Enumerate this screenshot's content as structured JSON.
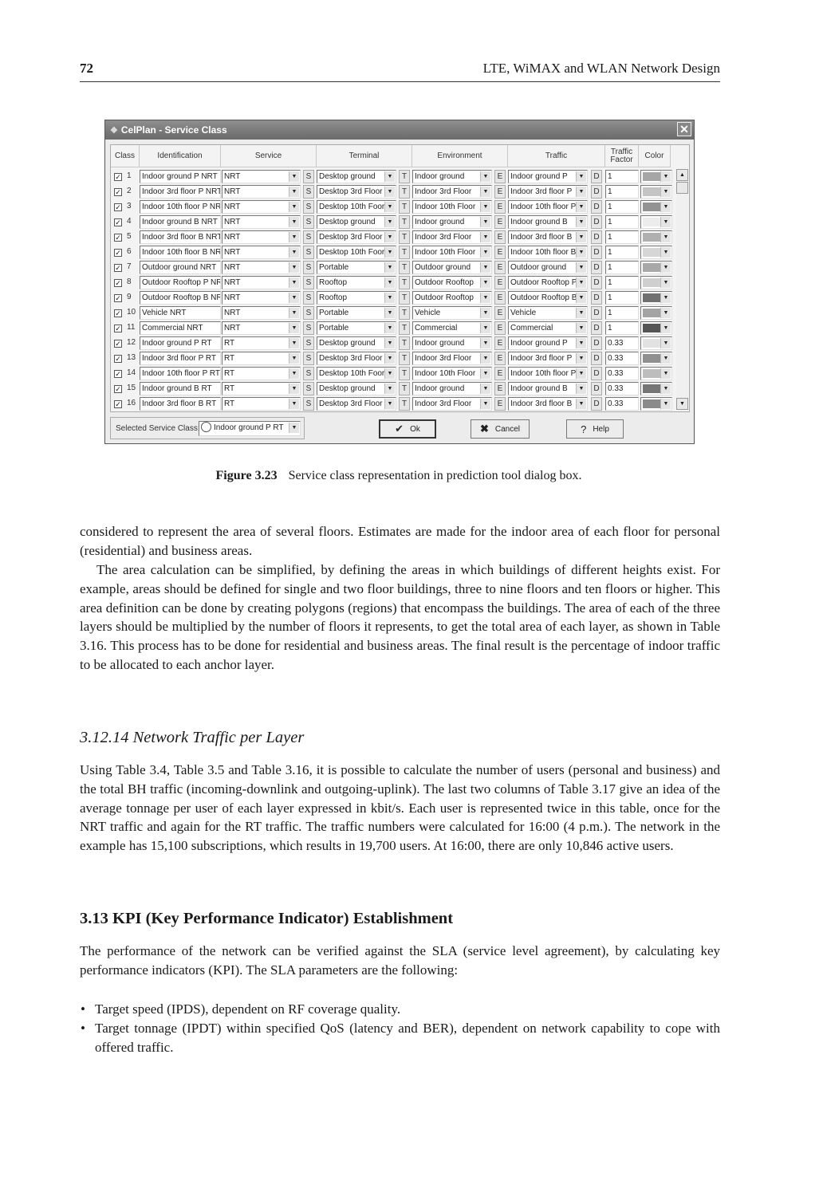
{
  "header": {
    "page_number": "72",
    "book_title": "LTE, WiMAX and WLAN Network Design"
  },
  "dialog": {
    "title": "CelPlan - Service Class",
    "close_icon": "close-icon",
    "columns": [
      "Class",
      "Identification",
      "Service",
      "Terminal",
      "Environment",
      "Traffic",
      "Traffic Factor",
      "Color"
    ],
    "button_letters": {
      "service": "S",
      "terminal": "T",
      "environment": "E",
      "traffic": "D"
    },
    "rows": [
      {
        "checked": true,
        "num": "1",
        "identification": "Indoor ground P NRT",
        "service": "NRT",
        "terminal": "Desktop ground",
        "environment": "Indoor ground",
        "traffic": "Indoor ground P",
        "factor": "1",
        "color": "#a6a6a6"
      },
      {
        "checked": true,
        "num": "2",
        "identification": "Indoor 3rd floor P NRT",
        "service": "NRT",
        "terminal": "Desktop 3rd Floor",
        "environment": "Indoor 3rd Floor",
        "traffic": "Indoor 3rd floor P",
        "factor": "1",
        "color": "#c4c4c4"
      },
      {
        "checked": true,
        "num": "3",
        "identification": "Indoor 10th floor P NR",
        "service": "NRT",
        "terminal": "Desktop 10th Foor",
        "environment": "Indoor 10th Floor",
        "traffic": "Indoor 10th floor P",
        "factor": "1",
        "color": "#939393"
      },
      {
        "checked": true,
        "num": "4",
        "identification": "Indoor ground B NRT",
        "service": "NRT",
        "terminal": "Desktop ground",
        "environment": "Indoor ground",
        "traffic": "Indoor ground B",
        "factor": "1",
        "color": "#ededed"
      },
      {
        "checked": true,
        "num": "5",
        "identification": "Indoor 3rd floor B NRT",
        "service": "NRT",
        "terminal": "Desktop 3rd Floor",
        "environment": "Indoor 3rd Floor",
        "traffic": "Indoor 3rd floor B",
        "factor": "1",
        "color": "#b0b0b0"
      },
      {
        "checked": true,
        "num": "6",
        "identification": "Indoor 10th floor B NR",
        "service": "NRT",
        "terminal": "Desktop 10th Foor",
        "environment": "Indoor 10th Floor",
        "traffic": "Indoor 10th floor B",
        "factor": "1",
        "color": "#d6d6d6"
      },
      {
        "checked": true,
        "num": "7",
        "identification": "Outdoor ground NRT",
        "service": "NRT",
        "terminal": "Portable",
        "environment": "Outdoor ground",
        "traffic": "Outdoor ground",
        "factor": "1",
        "color": "#a8a8a8"
      },
      {
        "checked": true,
        "num": "8",
        "identification": "Outdoor Rooftop P NR",
        "service": "NRT",
        "terminal": "Rooftop",
        "environment": "Outdoor Rooftop",
        "traffic": "Outdoor Rooftop P",
        "factor": "1",
        "color": "#cfcfcf"
      },
      {
        "checked": true,
        "num": "9",
        "identification": "Outdoor Rooftop B NR",
        "service": "NRT",
        "terminal": "Rooftop",
        "environment": "Outdoor Rooftop",
        "traffic": "Outdoor Rooftop B",
        "factor": "1",
        "color": "#707070"
      },
      {
        "checked": true,
        "num": "10",
        "identification": "Vehicle NRT",
        "service": "NRT",
        "terminal": "Portable",
        "environment": "Vehicle",
        "traffic": "Vehicle",
        "factor": "1",
        "color": "#a4a4a4"
      },
      {
        "checked": true,
        "num": "11",
        "identification": "Commercial NRT",
        "service": "NRT",
        "terminal": "Portable",
        "environment": "Commercial",
        "traffic": "Commercial",
        "factor": "1",
        "color": "#555555"
      },
      {
        "checked": true,
        "num": "12",
        "identification": "Indoor ground P RT",
        "service": "RT",
        "terminal": "Desktop ground",
        "environment": "Indoor ground",
        "traffic": "Indoor ground P",
        "factor": "0.33",
        "color": "#e2e2e2"
      },
      {
        "checked": true,
        "num": "13",
        "identification": "Indoor 3rd floor P RT",
        "service": "RT",
        "terminal": "Desktop 3rd Floor",
        "environment": "Indoor 3rd Floor",
        "traffic": "Indoor 3rd floor P",
        "factor": "0.33",
        "color": "#8f8f8f"
      },
      {
        "checked": true,
        "num": "14",
        "identification": "Indoor 10th floor P RT",
        "service": "RT",
        "terminal": "Desktop 10th Foor",
        "environment": "Indoor 10th Floor",
        "traffic": "Indoor 10th floor P",
        "factor": "0.33",
        "color": "#bdbdbd"
      },
      {
        "checked": true,
        "num": "15",
        "identification": "Indoor ground B RT",
        "service": "RT",
        "terminal": "Desktop ground",
        "environment": "Indoor ground",
        "traffic": "Indoor ground B",
        "factor": "0.33",
        "color": "#767676"
      },
      {
        "checked": true,
        "num": "16",
        "identification": "Indoor 3rd floor B RT",
        "service": "RT",
        "terminal": "Desktop 3rd Floor",
        "environment": "Indoor 3rd Floor",
        "traffic": "Indoor 3rd floor B",
        "factor": "0.33",
        "color": "#8a8a8a"
      }
    ],
    "selected_label": "Selected Service Class:",
    "selected_value": "Indoor ground P RT",
    "ok_label": "Ok",
    "cancel_label": "Cancel",
    "help_label": "Help"
  },
  "caption": {
    "label": "Figure 3.23",
    "text": "Service class representation in prediction tool dialog box."
  },
  "body": {
    "para1": "considered to represent the area of several floors. Estimates are made for the indoor area of each floor for personal (residential) and business areas.",
    "para2": "The area calculation can be simplified, by defining the areas in which buildings of different heights exist. For example, areas should be defined for single and two floor buildings, three to nine floors and ten floors or higher. This area definition can be done by creating polygons (regions) that encompass the buildings. The area of each of the three layers should be multiplied by the number of floors it represents, to get the total area of each layer, as shown in Table 3.16. This process has to be done for residential and business areas. The final result is the percentage of indoor traffic to be allocated to each anchor layer.",
    "subsection_heading": "3.12.14   Network Traffic per Layer",
    "para3": "Using Table 3.4, Table 3.5 and Table 3.16, it is possible to calculate the number of users (personal and business) and the total BH traffic (incoming-downlink and outgoing-uplink). The last two columns of Table 3.17 give an idea of the average tonnage per user of each layer expressed in kbit/s. Each user is represented twice in this table, once for the NRT traffic and again for the RT traffic. The traffic numbers were calculated for 16:00 (4 p.m.). The network in the example has 15,100 subscriptions, which results in 19,700 users. At 16:00, there are only 10,846 active users.",
    "section_heading": "3.13   KPI (Key Performance Indicator) Establishment",
    "para4": "The performance of the network can be verified against the SLA (service level agreement), by calculating key performance indicators (KPI). The SLA parameters are the following:",
    "bullets": [
      "Target speed (IPDS), dependent on RF coverage quality.",
      "Target tonnage (IPDT) within specified QoS (latency and BER), dependent on network capability to cope with offered traffic."
    ]
  }
}
